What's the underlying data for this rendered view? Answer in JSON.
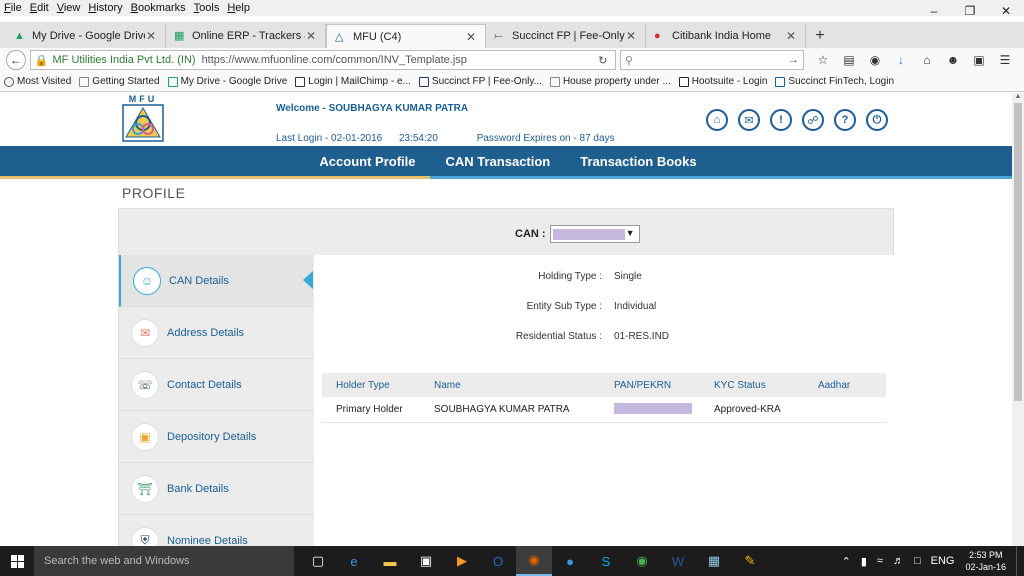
{
  "menubar": [
    "File",
    "Edit",
    "View",
    "History",
    "Bookmarks",
    "Tools",
    "Help"
  ],
  "tabs": [
    {
      "label": "My Drive - Google Drive",
      "active": false,
      "icon": "drive-icon",
      "color": "#1da462"
    },
    {
      "label": "Online ERP - Trackers & O...",
      "active": false,
      "icon": "sheets-icon",
      "color": "#0f9d58"
    },
    {
      "label": "MFU (C4)",
      "active": true,
      "icon": "mfu-icon",
      "color": "#1a5e96"
    },
    {
      "label": "Succinct FP | Fee-Only Fin...",
      "active": false,
      "icon": "succinct-icon",
      "color": "#2b3a67"
    },
    {
      "label": "Citibank India Home",
      "active": false,
      "icon": "citi-icon",
      "color": "#d32f2f"
    }
  ],
  "nav": {
    "site": "MF Utilities India Pvt Ltd. (IN)",
    "url": "https://www.mfuonline.com/common/INV_Template.jsp",
    "search_placeholder": ""
  },
  "bookmarks": [
    {
      "label": "Most Visited",
      "icon": "gear-icon"
    },
    {
      "label": "Getting Started",
      "icon": "page-icon"
    },
    {
      "label": "My Drive - Google Drive",
      "icon": "drive-icon"
    },
    {
      "label": "Login | MailChimp - e...",
      "icon": "mailchimp-icon"
    },
    {
      "label": "Succinct FP | Fee-Only...",
      "icon": "succinct-icon"
    },
    {
      "label": "House property under ...",
      "icon": "page-icon"
    },
    {
      "label": "Hootsuite - Login",
      "icon": "hootsuite-icon"
    },
    {
      "label": "Succinct FinTech, Login",
      "icon": "fintech-icon"
    }
  ],
  "header": {
    "logo_text": "MFU",
    "welcome": "Welcome - SOUBHAGYA KUMAR PATRA",
    "last_login_label": "Last Login - 02-01-2016",
    "last_login_time": "23:54:20",
    "password_expiry": "Password Expires on - 87 days"
  },
  "main_nav": [
    "Account Profile",
    "CAN Transaction",
    "Transaction Books"
  ],
  "profile_title": "PROFILE",
  "can": {
    "label": "CAN :"
  },
  "sidebar": [
    {
      "label": "CAN Details",
      "icon": "user-icon",
      "color": "#33a9dc",
      "active": true
    },
    {
      "label": "Address Details",
      "icon": "envelope-icon",
      "color": "#e8735a",
      "active": false
    },
    {
      "label": "Contact Details",
      "icon": "phone-icon",
      "color": "#2b4c6b",
      "active": false
    },
    {
      "label": "Depository Details",
      "icon": "briefcase-icon",
      "color": "#f0a92e",
      "active": false
    },
    {
      "label": "Bank Details",
      "icon": "bank-icon",
      "color": "#2e9a5e",
      "active": false
    },
    {
      "label": "Nominee Details",
      "icon": "shield-icon",
      "color": "#1a3e6e",
      "active": false
    }
  ],
  "details": [
    {
      "key": "Holding Type :",
      "value": "Single"
    },
    {
      "key": "Entity Sub Type :",
      "value": "Individual"
    },
    {
      "key": "Residential Status :",
      "value": "01-RES.IND"
    }
  ],
  "holders_table": {
    "headers": [
      "Holder Type",
      "Name",
      "PAN/PEKRN",
      "KYC Status",
      "Aadhar"
    ],
    "rows": [
      {
        "holder_type": "Primary Holder",
        "name": "SOUBHAGYA KUMAR PATRA",
        "pan": "",
        "kyc": "Approved-KRA",
        "aadhar": ""
      }
    ]
  },
  "taskbar": {
    "search": "Search the web and Windows",
    "apps": [
      "task-view-icon",
      "edge-icon",
      "explorer-icon",
      "store-icon",
      "media-icon",
      "outlook-icon",
      "firefox-icon",
      "skype-a-icon",
      "skype-icon",
      "chrome-icon",
      "word-icon",
      "notepad-icon",
      "paint-icon"
    ],
    "lang": "ENG",
    "time": "2:53 PM",
    "date": "02-Jan-16"
  }
}
